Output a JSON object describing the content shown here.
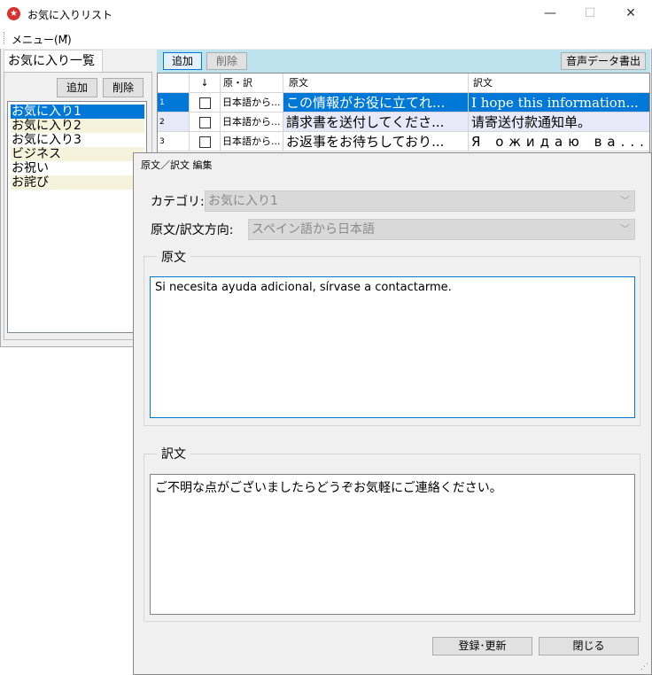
{
  "window": {
    "title": "お気に入りリスト",
    "icon": "star-icon",
    "minimize_glyph": "—",
    "maximize_glyph": "☐",
    "close_glyph": "✕"
  },
  "menu": {
    "label": "メニュー(M)",
    "caret": "▾"
  },
  "left": {
    "tab_label": "お気に入り一覧",
    "add_label": "追加",
    "delete_label": "削除",
    "items": [
      "お気に入り1",
      "お気に入り2",
      "お気に入り3",
      "ビジネス",
      "お祝い",
      "お詫び"
    ],
    "selected_index": 0
  },
  "toolbar": {
    "add_label": "追加",
    "delete_label": "削除",
    "audio_label": "音声データ書出"
  },
  "grid": {
    "headers": [
      "",
      "↓",
      "原・訳",
      "原文",
      "訳文"
    ],
    "rows": [
      {
        "num": "1",
        "dir": "日本語から...",
        "source": "この情報がお役に立てれ...",
        "target": "I hope this information...",
        "selected": true
      },
      {
        "num": "2",
        "dir": "日本語から...",
        "source": "請求書を送付してくださ...",
        "target": "请寄送付款通知单。",
        "selected": false
      },
      {
        "num": "3",
        "dir": "日本語から...",
        "source": "お返事をお待ちしており...",
        "target": "Я ожидаю ва...",
        "selected": false
      }
    ]
  },
  "dialog": {
    "title": "原文／訳文 編集",
    "category_label": "カテゴリ:",
    "category_value": "お気に入り1",
    "direction_label": "原文/訳文方向:",
    "direction_value": "スペイン語から日本語",
    "source_legend": "原文",
    "source_text": "Si necesita ayuda adicional, sírvase a contactarme.",
    "target_legend": "訳文",
    "target_text": "ご不明な点がございましたらどうぞお気軽にご連絡ください。",
    "save_label": "登録･更新",
    "close_label": "閉じる"
  },
  "colors": {
    "selection": "#0078d7",
    "toolbar_bg": "#bde3ef",
    "alt_row": "#f5f3dc",
    "row2_bg": "#e8e8f8"
  }
}
